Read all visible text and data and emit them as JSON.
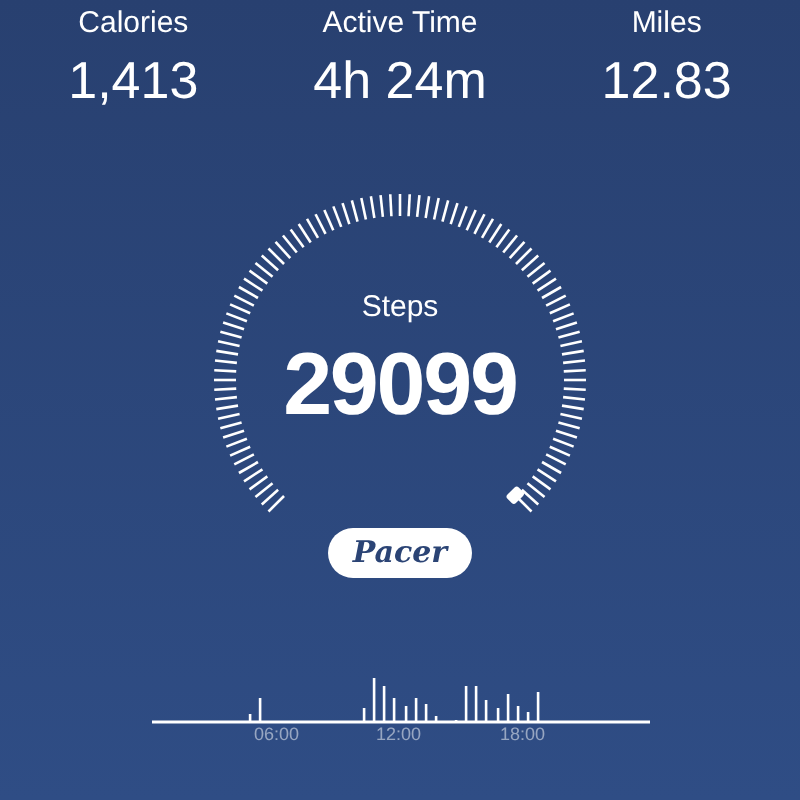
{
  "stats": [
    {
      "label": "Calories",
      "value": "1,413"
    },
    {
      "label": "Active Time",
      "value": "4h 24m"
    },
    {
      "label": "Miles",
      "value": "12.83"
    }
  ],
  "gauge": {
    "label": "Steps",
    "value": "29099"
  },
  "brand": "Pacer",
  "timeline": {
    "time_labels": [
      "06:00",
      "12:00",
      "18:00"
    ]
  }
}
